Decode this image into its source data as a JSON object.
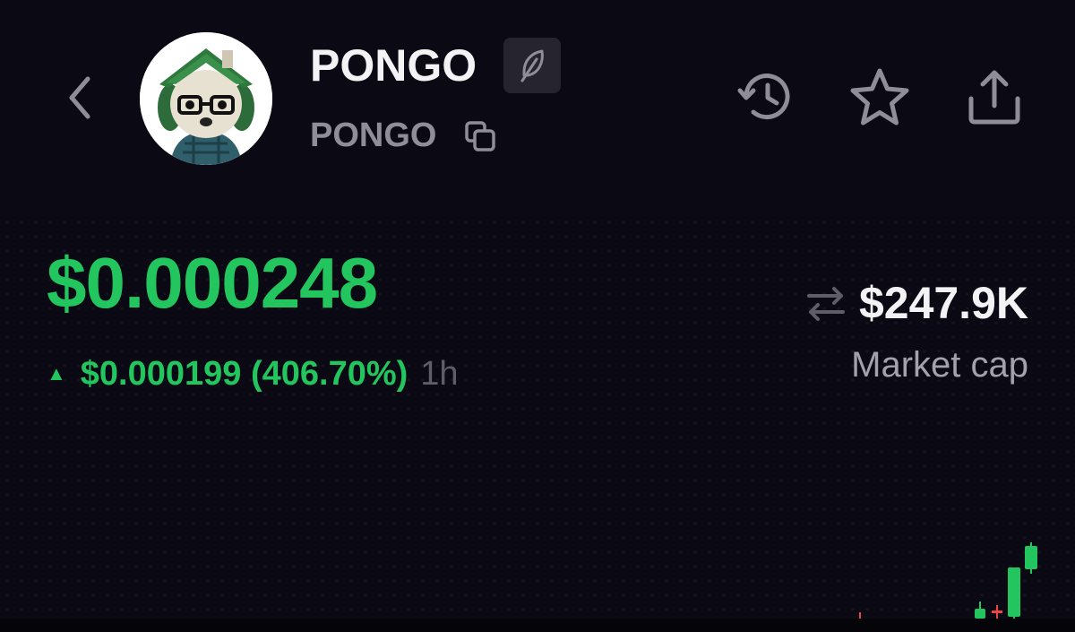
{
  "header": {
    "token_name": "PONGO",
    "token_ticker": "PONGO",
    "icons": [
      "chevron-left-icon",
      "feather-icon",
      "copy-icon",
      "history-icon",
      "star-icon",
      "share-icon"
    ]
  },
  "price": {
    "current": "$0.000248",
    "change": "$0.000199 (406.70%)",
    "period": "1h",
    "direction": "up"
  },
  "market_cap": {
    "value": "$247.9K",
    "label": "Market cap"
  },
  "colors": {
    "background": "#0b0a14",
    "positive": "#22c55e",
    "negative": "#ef4444",
    "muted": "#8e8d98"
  }
}
